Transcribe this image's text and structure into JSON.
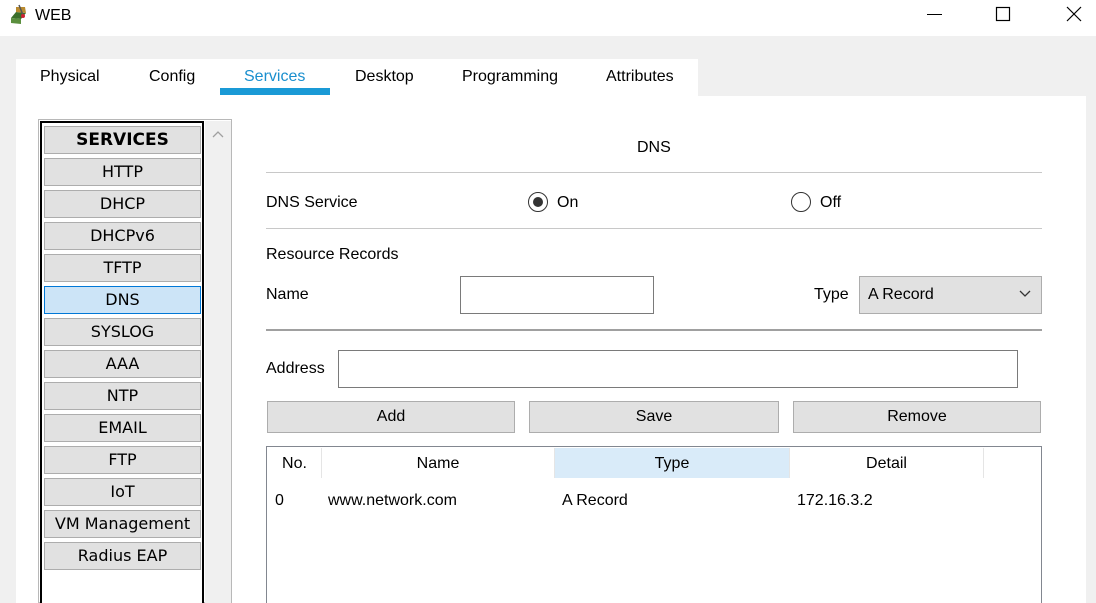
{
  "window": {
    "title": "WEB",
    "icon": "packet-tracer-server-icon",
    "controls": [
      "minimize-icon",
      "maximize-icon",
      "close-icon"
    ]
  },
  "tabs": [
    {
      "label": "Physical",
      "active": false
    },
    {
      "label": "Config",
      "active": false
    },
    {
      "label": "Services",
      "active": true
    },
    {
      "label": "Desktop",
      "active": false
    },
    {
      "label": "Programming",
      "active": false
    },
    {
      "label": "Attributes",
      "active": false
    }
  ],
  "services": {
    "header": "SERVICES",
    "items": [
      "HTTP",
      "DHCP",
      "DHCPv6",
      "TFTP",
      "DNS",
      "SYSLOG",
      "AAA",
      "NTP",
      "EMAIL",
      "FTP",
      "IoT",
      "VM Management",
      "Radius EAP"
    ],
    "selected": "DNS"
  },
  "dns": {
    "title": "DNS",
    "service_label": "DNS Service",
    "on_label": "On",
    "off_label": "Off",
    "service_state": "On",
    "resource_records_label": "Resource Records",
    "name_label": "Name",
    "name_value": "",
    "type_label": "Type",
    "type_value": "A Record",
    "address_label": "Address",
    "address_value": "",
    "buttons": {
      "add": "Add",
      "save": "Save",
      "remove": "Remove"
    },
    "table": {
      "columns": [
        "No.",
        "Name",
        "Type",
        "Detail"
      ],
      "highlighted_column": "Type",
      "rows": [
        {
          "no": "0",
          "name": "www.network.com",
          "type": "A Record",
          "detail": "172.16.3.2"
        }
      ]
    }
  },
  "colors": {
    "accent": "#1a9ad6",
    "selected_bg": "#cce4f7",
    "button_bg": "#e1e1e1"
  }
}
